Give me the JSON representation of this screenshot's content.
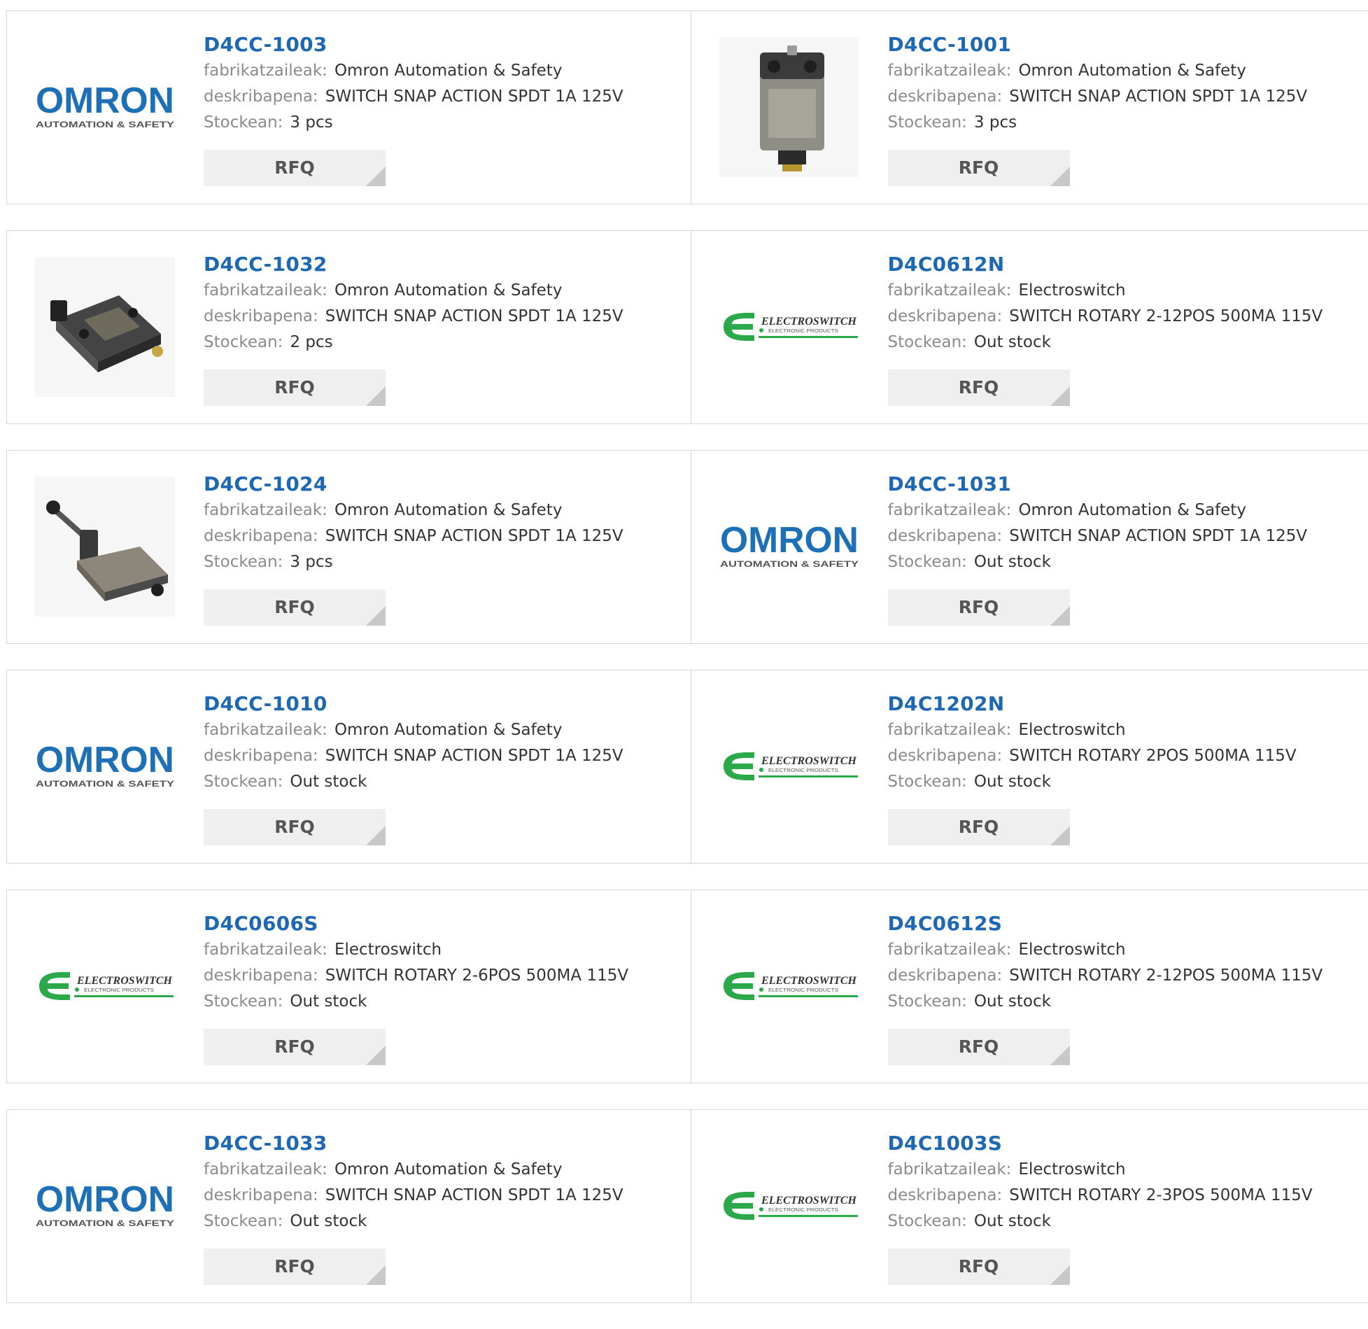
{
  "labels": {
    "manufacturer": "fabrikatzaileak:",
    "description": "deskribapena:",
    "stock": "Stockean:"
  },
  "rfq_label": "RFQ",
  "logos": {
    "omron": {
      "name": "OMRON",
      "tagline": "AUTOMATION & SAFETY",
      "color": "#1d6fb6"
    },
    "electroswitch": {
      "name": "ELECTROSWITCH",
      "tagline": "ELECTRONIC PRODUCTS",
      "color": "#2aa84a"
    }
  },
  "products": [
    {
      "part": "D4CC-1003",
      "manufacturer": "Omron Automation & Safety",
      "description": "SWITCH SNAP ACTION SPDT 1A 125V",
      "stock": "3 pcs",
      "image": "omron-logo"
    },
    {
      "part": "D4CC-1001",
      "manufacturer": "Omron Automation & Safety",
      "description": "SWITCH SNAP ACTION SPDT 1A 125V",
      "stock": "3 pcs",
      "image": "switch-photo-upright"
    },
    {
      "part": "D4CC-1032",
      "manufacturer": "Omron Automation & Safety",
      "description": "SWITCH SNAP ACTION SPDT 1A 125V",
      "stock": "2 pcs",
      "image": "switch-photo-angled"
    },
    {
      "part": "D4C0612N",
      "manufacturer": "Electroswitch",
      "description": "SWITCH ROTARY 2-12POS 500MA 115V",
      "stock": "Out stock",
      "image": "electroswitch-logo"
    },
    {
      "part": "D4CC-1024",
      "manufacturer": "Omron Automation & Safety",
      "description": "SWITCH SNAP ACTION SPDT 1A 125V",
      "stock": "3 pcs",
      "image": "switch-photo-lever"
    },
    {
      "part": "D4CC-1031",
      "manufacturer": "Omron Automation & Safety",
      "description": "SWITCH SNAP ACTION SPDT 1A 125V",
      "stock": "Out stock",
      "image": "omron-logo"
    },
    {
      "part": "D4CC-1010",
      "manufacturer": "Omron Automation & Safety",
      "description": "SWITCH SNAP ACTION SPDT 1A 125V",
      "stock": "Out stock",
      "image": "omron-logo"
    },
    {
      "part": "D4C1202N",
      "manufacturer": "Electroswitch",
      "description": "SWITCH ROTARY 2POS 500MA 115V",
      "stock": "Out stock",
      "image": "electroswitch-logo"
    },
    {
      "part": "D4C0606S",
      "manufacturer": "Electroswitch",
      "description": "SWITCH ROTARY 2-6POS 500MA 115V",
      "stock": "Out stock",
      "image": "electroswitch-logo"
    },
    {
      "part": "D4C0612S",
      "manufacturer": "Electroswitch",
      "description": "SWITCH ROTARY 2-12POS 500MA 115V",
      "stock": "Out stock",
      "image": "electroswitch-logo"
    },
    {
      "part": "D4CC-1033",
      "manufacturer": "Omron Automation & Safety",
      "description": "SWITCH SNAP ACTION SPDT 1A 125V",
      "stock": "Out stock",
      "image": "omron-logo"
    },
    {
      "part": "D4C1003S",
      "manufacturer": "Electroswitch",
      "description": "SWITCH ROTARY 2-3POS 500MA 115V",
      "stock": "Out stock",
      "image": "electroswitch-logo"
    }
  ]
}
